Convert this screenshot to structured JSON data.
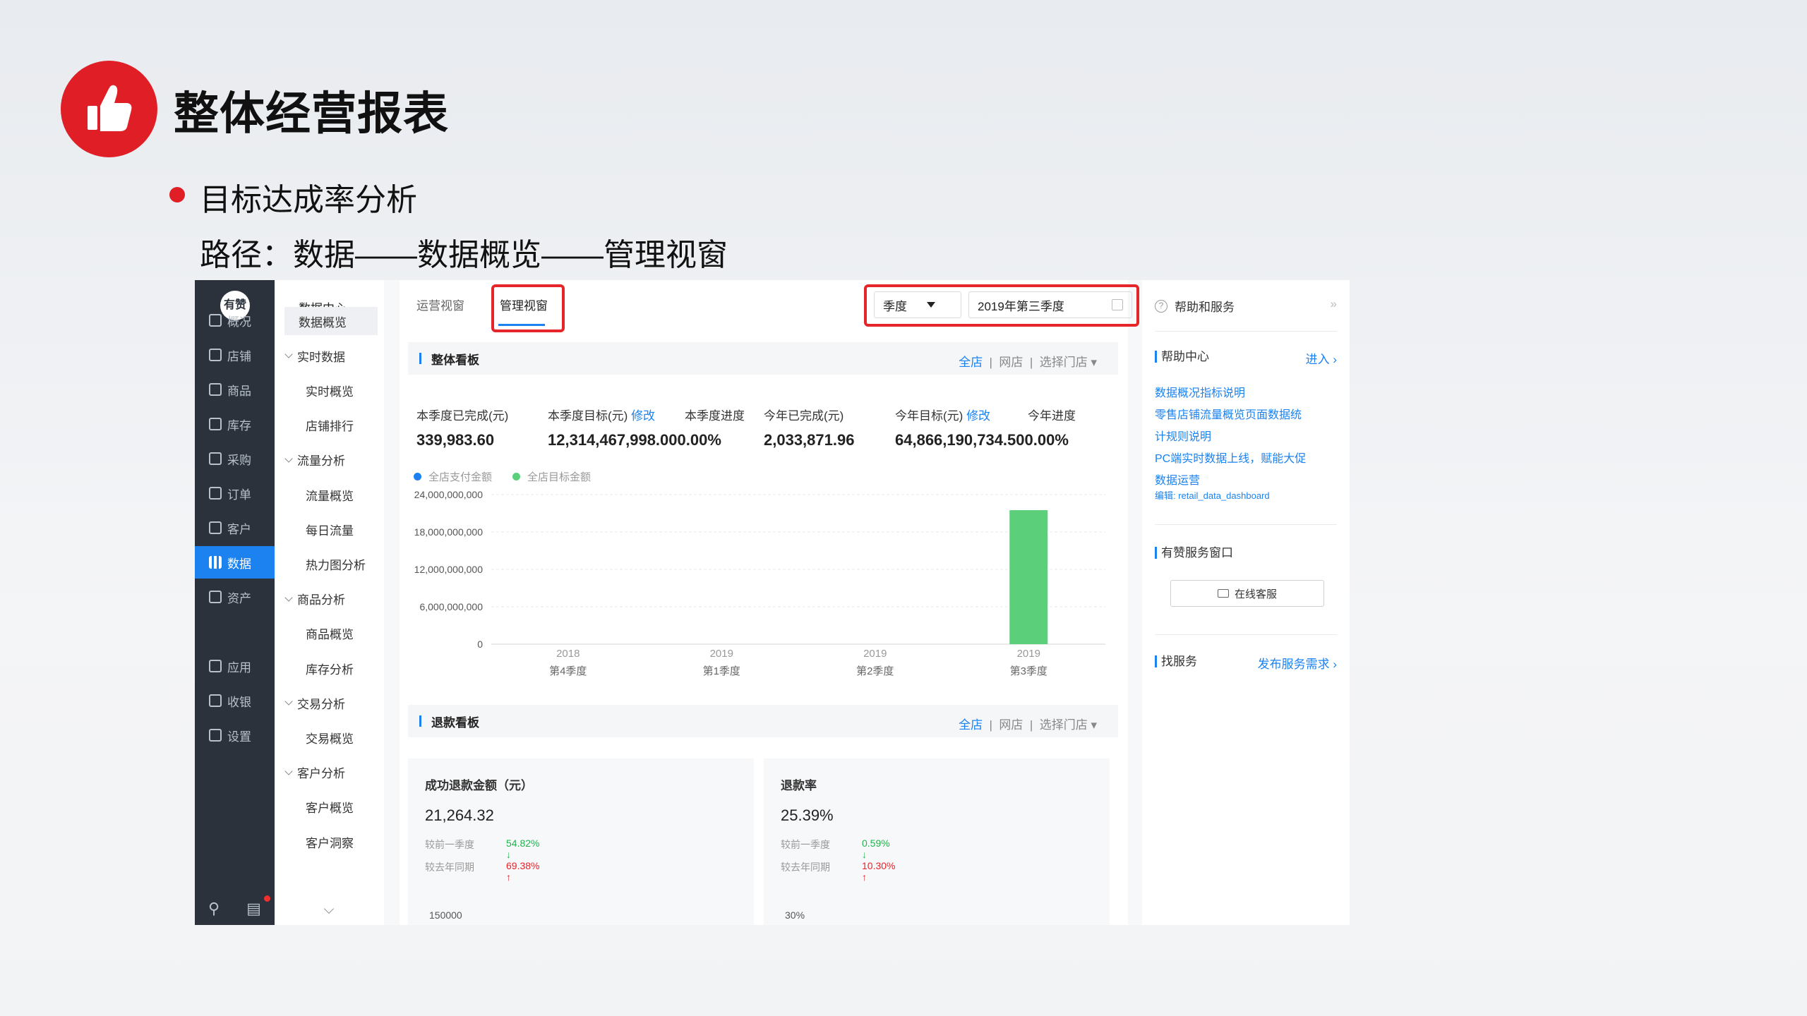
{
  "slide": {
    "title": "整体经营报表",
    "bullet": "目标达成率分析",
    "path": "路径：数据——数据概览——管理视窗"
  },
  "sidebar": {
    "brand": "有赞",
    "items": [
      {
        "label": "概况",
        "icon": "monitor-icon"
      },
      {
        "label": "店铺",
        "icon": "store-icon"
      },
      {
        "label": "商品",
        "icon": "tag-icon"
      },
      {
        "label": "库存",
        "icon": "warehouse-icon"
      },
      {
        "label": "采购",
        "icon": "purchase-icon"
      },
      {
        "label": "订单",
        "icon": "order-icon"
      },
      {
        "label": "客户",
        "icon": "user-icon"
      },
      {
        "label": "数据",
        "icon": "bar-chart-icon",
        "active": true
      },
      {
        "label": "资产",
        "icon": "yen-icon"
      },
      {
        "label": "应用",
        "icon": "apps-icon"
      },
      {
        "label": "收银",
        "icon": "cashier-icon"
      },
      {
        "label": "设置",
        "icon": "gear-icon"
      }
    ]
  },
  "subnav": {
    "header": "数据中心",
    "items": [
      {
        "label": "数据概览",
        "type": "selected"
      },
      {
        "label": "实时数据",
        "type": "group"
      },
      {
        "label": "实时概览",
        "type": "leaf"
      },
      {
        "label": "店铺排行",
        "type": "leaf"
      },
      {
        "label": "流量分析",
        "type": "group"
      },
      {
        "label": "流量概览",
        "type": "leaf"
      },
      {
        "label": "每日流量",
        "type": "leaf"
      },
      {
        "label": "热力图分析",
        "type": "leaf"
      },
      {
        "label": "商品分析",
        "type": "group"
      },
      {
        "label": "商品概览",
        "type": "leaf"
      },
      {
        "label": "库存分析",
        "type": "leaf"
      },
      {
        "label": "交易分析",
        "type": "group"
      },
      {
        "label": "交易概览",
        "type": "leaf"
      },
      {
        "label": "客户分析",
        "type": "group"
      },
      {
        "label": "客户概览",
        "type": "leaf"
      },
      {
        "label": "客户洞察",
        "type": "leaf"
      }
    ]
  },
  "tabs": [
    "运营视窗",
    "管理视窗"
  ],
  "period": {
    "type": "季度",
    "value": "2019年第三季度"
  },
  "overview": {
    "title": "整体看板",
    "filters": {
      "all": "全店",
      "online": "网店",
      "pick": "选择门店 ▾"
    },
    "kpis": [
      {
        "label": "本季度已完成(元)",
        "value": "339,983.60"
      },
      {
        "label": "本季度目标(元)",
        "edit": "修改",
        "value": "12,314,467,998.000.00%"
      },
      {
        "label": "本季度进度",
        "value": ""
      },
      {
        "label": "今年已完成(元)",
        "value": "2,033,871.96"
      },
      {
        "label": "今年目标(元)",
        "edit": "修改",
        "value": "64,866,190,734.500.00%"
      },
      {
        "label": "今年进度",
        "value": ""
      }
    ],
    "legend": [
      "全店支付金额",
      "全店目标金额"
    ]
  },
  "chart_data": {
    "type": "bar",
    "categories": [
      "2018 第4季度",
      "2019 第1季度",
      "2019 第2季度",
      "2019 第3季度"
    ],
    "category_lines": [
      [
        "2018",
        "第4季度"
      ],
      [
        "2019",
        "第1季度"
      ],
      [
        "2019",
        "第2季度"
      ],
      [
        "2019",
        "第3季度"
      ]
    ],
    "series": [
      {
        "name": "全店支付金额",
        "color": "#1b82f0",
        "values": [
          0,
          0,
          0,
          0
        ]
      },
      {
        "name": "全店目标金额",
        "color": "#5ccf7a",
        "values": [
          0,
          0,
          0,
          21500000000
        ]
      }
    ],
    "yticks": [
      0,
      6000000000,
      12000000000,
      18000000000,
      24000000000
    ],
    "ytick_labels": [
      "0",
      "6,000,000,000",
      "12,000,000,000",
      "18,000,000,000",
      "24,000,000,000"
    ],
    "ylim": [
      0,
      24000000000
    ],
    "grid": true,
    "legend_position": "top-left"
  },
  "refund": {
    "title": "退款看板",
    "filters": {
      "all": "全店",
      "online": "网店",
      "pick": "选择门店 ▾"
    },
    "panels": [
      {
        "title": "成功退款金额（元）",
        "value": "21,264.32",
        "rows": [
          {
            "label": "较前一季度",
            "value": "54.82%",
            "dir": "down",
            "arrow": "↓"
          },
          {
            "label": "较去年同期",
            "value": "69.38%",
            "dir": "up",
            "arrow": "↑"
          }
        ],
        "axis_top": "150000"
      },
      {
        "title": "退款率",
        "value": "25.39%",
        "rows": [
          {
            "label": "较前一季度",
            "value": "0.59%",
            "dir": "down",
            "arrow": "↓"
          },
          {
            "label": "较去年同期",
            "value": "10.30%",
            "dir": "up",
            "arrow": "↑"
          }
        ],
        "axis_top": "30%"
      }
    ]
  },
  "help": {
    "title": "帮助和服务",
    "center": "帮助中心",
    "enter": "进入 ›",
    "links": [
      "数据概况指标说明",
      "零售店铺流量概览页面数据统",
      "计规则说明",
      "PC端实时数据上线，赋能大促",
      "数据运营"
    ],
    "editor_note": "编辑: retail_data_dashboard",
    "window": "有赞服务窗口",
    "online_service": "在线客服",
    "find_service": "找服务",
    "post_need": "发布服务需求 ›"
  }
}
